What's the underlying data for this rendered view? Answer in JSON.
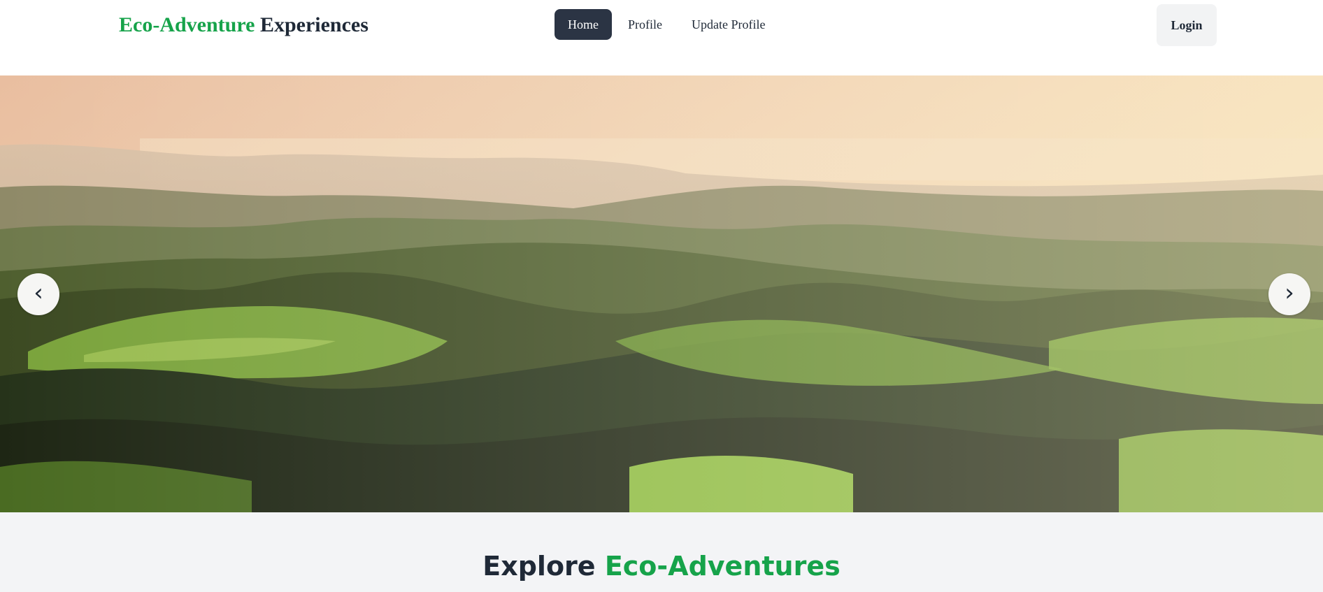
{
  "navbar": {
    "brand_accent": "Eco-Adventure",
    "brand_rest": "Experiences",
    "links": [
      {
        "label": "Home",
        "active": true
      },
      {
        "label": "Profile",
        "active": false
      },
      {
        "label": "Update Profile",
        "active": false
      }
    ],
    "login_label": "Login"
  },
  "hero": {
    "image": "forest-hills-landscape",
    "prev_icon": "‹",
    "next_icon": "›"
  },
  "section": {
    "title_part1": "Explore",
    "title_part2": "Eco-Adventures"
  },
  "colors": {
    "accent_green": "#16a34a",
    "dark_text": "#1f2937",
    "active_nav_bg": "#2b3444",
    "section_bg": "#f3f4f6"
  }
}
